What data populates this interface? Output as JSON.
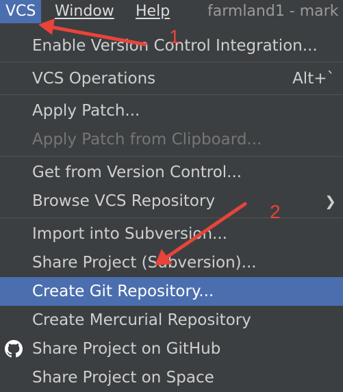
{
  "menubar": {
    "vcs": "VCS",
    "window": "Window",
    "help": "Help",
    "title": "farmland1 - mark"
  },
  "menu": {
    "enable_vci": "Enable Version Control Integration...",
    "vcs_operations": "VCS Operations",
    "vcs_operations_shortcut": "Alt+`",
    "apply_patch": "Apply Patch...",
    "apply_patch_clipboard": "Apply Patch from Clipboard...",
    "get_from_vc": "Get from Version Control...",
    "browse_vcs_repo": "Browse VCS Repository",
    "import_subversion": "Import into Subversion...",
    "share_project_svn": "Share Project (Subversion)...",
    "create_git_repo": "Create Git Repository...",
    "create_mercurial": "Create Mercurial Repository",
    "share_github": "Share Project on GitHub",
    "share_space": "Share Project on Space"
  },
  "annotations": {
    "step1": "1",
    "step2": "2",
    "arrow_color": "#e8443a"
  },
  "icons": {
    "submenu": "chevron-right-icon",
    "github": "github-icon"
  },
  "colors": {
    "menu_bg": "#3c3f41",
    "selection": "#4b6eaf",
    "disabled_text": "#767676"
  }
}
